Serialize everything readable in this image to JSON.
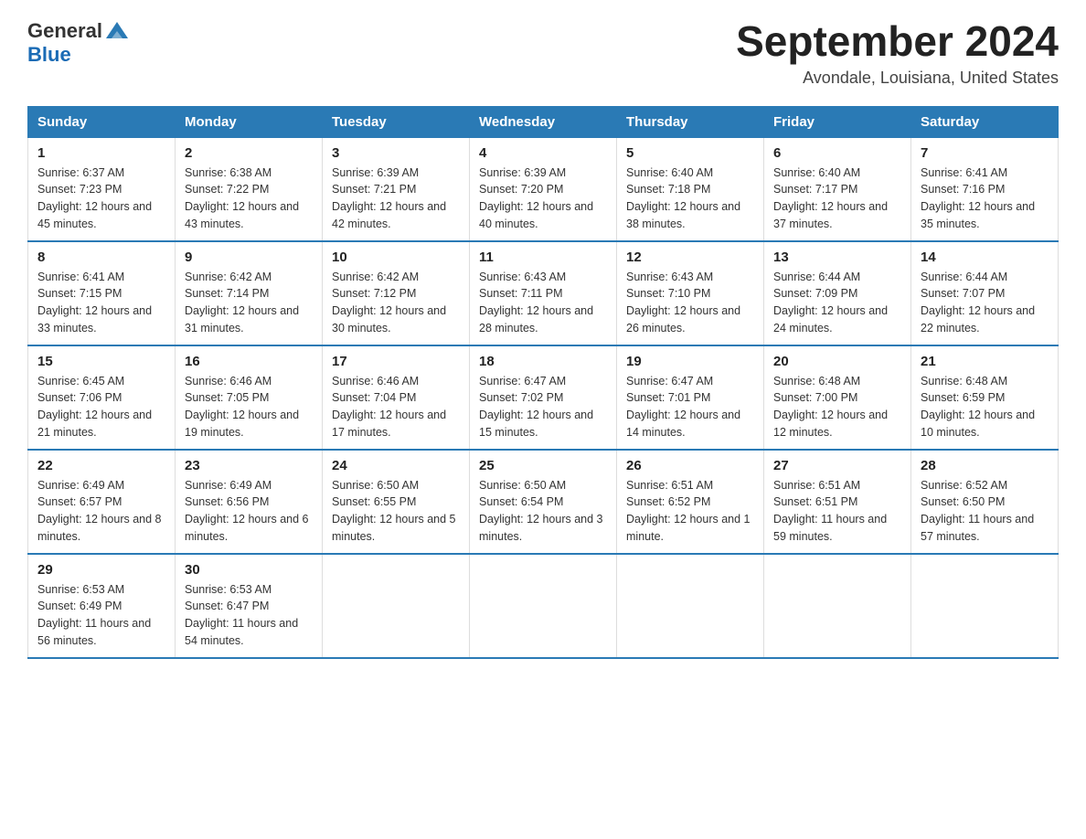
{
  "header": {
    "logo_general": "General",
    "logo_blue": "Blue",
    "title": "September 2024",
    "subtitle": "Avondale, Louisiana, United States"
  },
  "weekdays": [
    "Sunday",
    "Monday",
    "Tuesday",
    "Wednesday",
    "Thursday",
    "Friday",
    "Saturday"
  ],
  "weeks": [
    [
      {
        "day": "1",
        "sunrise": "Sunrise: 6:37 AM",
        "sunset": "Sunset: 7:23 PM",
        "daylight": "Daylight: 12 hours and 45 minutes."
      },
      {
        "day": "2",
        "sunrise": "Sunrise: 6:38 AM",
        "sunset": "Sunset: 7:22 PM",
        "daylight": "Daylight: 12 hours and 43 minutes."
      },
      {
        "day": "3",
        "sunrise": "Sunrise: 6:39 AM",
        "sunset": "Sunset: 7:21 PM",
        "daylight": "Daylight: 12 hours and 42 minutes."
      },
      {
        "day": "4",
        "sunrise": "Sunrise: 6:39 AM",
        "sunset": "Sunset: 7:20 PM",
        "daylight": "Daylight: 12 hours and 40 minutes."
      },
      {
        "day": "5",
        "sunrise": "Sunrise: 6:40 AM",
        "sunset": "Sunset: 7:18 PM",
        "daylight": "Daylight: 12 hours and 38 minutes."
      },
      {
        "day": "6",
        "sunrise": "Sunrise: 6:40 AM",
        "sunset": "Sunset: 7:17 PM",
        "daylight": "Daylight: 12 hours and 37 minutes."
      },
      {
        "day": "7",
        "sunrise": "Sunrise: 6:41 AM",
        "sunset": "Sunset: 7:16 PM",
        "daylight": "Daylight: 12 hours and 35 minutes."
      }
    ],
    [
      {
        "day": "8",
        "sunrise": "Sunrise: 6:41 AM",
        "sunset": "Sunset: 7:15 PM",
        "daylight": "Daylight: 12 hours and 33 minutes."
      },
      {
        "day": "9",
        "sunrise": "Sunrise: 6:42 AM",
        "sunset": "Sunset: 7:14 PM",
        "daylight": "Daylight: 12 hours and 31 minutes."
      },
      {
        "day": "10",
        "sunrise": "Sunrise: 6:42 AM",
        "sunset": "Sunset: 7:12 PM",
        "daylight": "Daylight: 12 hours and 30 minutes."
      },
      {
        "day": "11",
        "sunrise": "Sunrise: 6:43 AM",
        "sunset": "Sunset: 7:11 PM",
        "daylight": "Daylight: 12 hours and 28 minutes."
      },
      {
        "day": "12",
        "sunrise": "Sunrise: 6:43 AM",
        "sunset": "Sunset: 7:10 PM",
        "daylight": "Daylight: 12 hours and 26 minutes."
      },
      {
        "day": "13",
        "sunrise": "Sunrise: 6:44 AM",
        "sunset": "Sunset: 7:09 PM",
        "daylight": "Daylight: 12 hours and 24 minutes."
      },
      {
        "day": "14",
        "sunrise": "Sunrise: 6:44 AM",
        "sunset": "Sunset: 7:07 PM",
        "daylight": "Daylight: 12 hours and 22 minutes."
      }
    ],
    [
      {
        "day": "15",
        "sunrise": "Sunrise: 6:45 AM",
        "sunset": "Sunset: 7:06 PM",
        "daylight": "Daylight: 12 hours and 21 minutes."
      },
      {
        "day": "16",
        "sunrise": "Sunrise: 6:46 AM",
        "sunset": "Sunset: 7:05 PM",
        "daylight": "Daylight: 12 hours and 19 minutes."
      },
      {
        "day": "17",
        "sunrise": "Sunrise: 6:46 AM",
        "sunset": "Sunset: 7:04 PM",
        "daylight": "Daylight: 12 hours and 17 minutes."
      },
      {
        "day": "18",
        "sunrise": "Sunrise: 6:47 AM",
        "sunset": "Sunset: 7:02 PM",
        "daylight": "Daylight: 12 hours and 15 minutes."
      },
      {
        "day": "19",
        "sunrise": "Sunrise: 6:47 AM",
        "sunset": "Sunset: 7:01 PM",
        "daylight": "Daylight: 12 hours and 14 minutes."
      },
      {
        "day": "20",
        "sunrise": "Sunrise: 6:48 AM",
        "sunset": "Sunset: 7:00 PM",
        "daylight": "Daylight: 12 hours and 12 minutes."
      },
      {
        "day": "21",
        "sunrise": "Sunrise: 6:48 AM",
        "sunset": "Sunset: 6:59 PM",
        "daylight": "Daylight: 12 hours and 10 minutes."
      }
    ],
    [
      {
        "day": "22",
        "sunrise": "Sunrise: 6:49 AM",
        "sunset": "Sunset: 6:57 PM",
        "daylight": "Daylight: 12 hours and 8 minutes."
      },
      {
        "day": "23",
        "sunrise": "Sunrise: 6:49 AM",
        "sunset": "Sunset: 6:56 PM",
        "daylight": "Daylight: 12 hours and 6 minutes."
      },
      {
        "day": "24",
        "sunrise": "Sunrise: 6:50 AM",
        "sunset": "Sunset: 6:55 PM",
        "daylight": "Daylight: 12 hours and 5 minutes."
      },
      {
        "day": "25",
        "sunrise": "Sunrise: 6:50 AM",
        "sunset": "Sunset: 6:54 PM",
        "daylight": "Daylight: 12 hours and 3 minutes."
      },
      {
        "day": "26",
        "sunrise": "Sunrise: 6:51 AM",
        "sunset": "Sunset: 6:52 PM",
        "daylight": "Daylight: 12 hours and 1 minute."
      },
      {
        "day": "27",
        "sunrise": "Sunrise: 6:51 AM",
        "sunset": "Sunset: 6:51 PM",
        "daylight": "Daylight: 11 hours and 59 minutes."
      },
      {
        "day": "28",
        "sunrise": "Sunrise: 6:52 AM",
        "sunset": "Sunset: 6:50 PM",
        "daylight": "Daylight: 11 hours and 57 minutes."
      }
    ],
    [
      {
        "day": "29",
        "sunrise": "Sunrise: 6:53 AM",
        "sunset": "Sunset: 6:49 PM",
        "daylight": "Daylight: 11 hours and 56 minutes."
      },
      {
        "day": "30",
        "sunrise": "Sunrise: 6:53 AM",
        "sunset": "Sunset: 6:47 PM",
        "daylight": "Daylight: 11 hours and 54 minutes."
      },
      null,
      null,
      null,
      null,
      null
    ]
  ]
}
